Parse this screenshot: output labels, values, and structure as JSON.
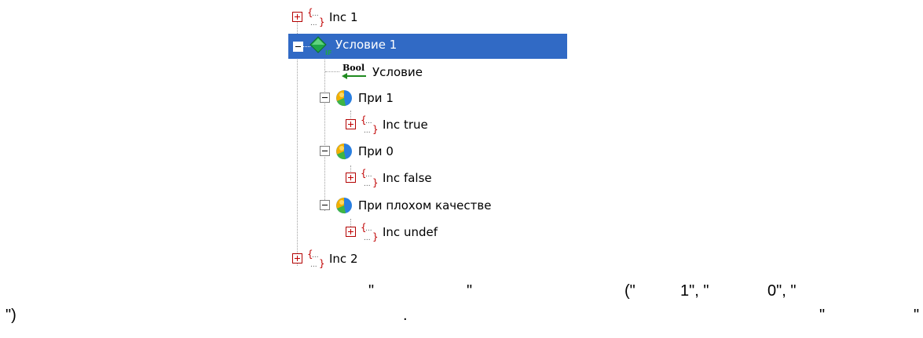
{
  "tree": {
    "nodes": [
      {
        "id": "inc-1",
        "label": "Inc 1",
        "icon": "code-block-icon",
        "toggle": "plus"
      },
      {
        "id": "condition-1",
        "label": "Условие 1",
        "icon": "if-diamond-icon",
        "toggle": "minus",
        "selected": true
      },
      {
        "id": "condition-input",
        "label": "Условие",
        "icon": "bool-input-icon",
        "icon_text": "Bool"
      },
      {
        "id": "branch-1",
        "label": "При 1",
        "icon": "branch-ball-icon",
        "toggle": "minus"
      },
      {
        "id": "inc-true",
        "label": "Inc true",
        "icon": "code-block-icon",
        "toggle": "plus"
      },
      {
        "id": "branch-0",
        "label": "При 0",
        "icon": "branch-ball-icon",
        "toggle": "minus"
      },
      {
        "id": "inc-false",
        "label": "Inc false",
        "icon": "code-block-icon",
        "toggle": "plus"
      },
      {
        "id": "branch-bad-quality",
        "label": "При плохом качестве",
        "icon": "branch-ball-icon",
        "toggle": "minus"
      },
      {
        "id": "inc-undef",
        "label": "Inc undef",
        "icon": "code-block-icon",
        "toggle": "plus"
      },
      {
        "id": "inc-2",
        "label": "Inc 2",
        "icon": "code-block-icon",
        "toggle": "plus"
      }
    ],
    "colors": {
      "selection": "#316ac5",
      "toggle_red": "#c00000",
      "diamond": "#1fa64a",
      "bool_arrow": "#1f8a1f"
    }
  },
  "caption": {
    "line1": {
      "quote_a": "\"",
      "quote_b": "\"",
      "open": "(\"",
      "one": "1\", \"",
      "zero": "0\", \""
    },
    "line2": {
      "close": "\")",
      "dot": ".",
      "quote_c": "\"",
      "quote_d": "\""
    }
  }
}
